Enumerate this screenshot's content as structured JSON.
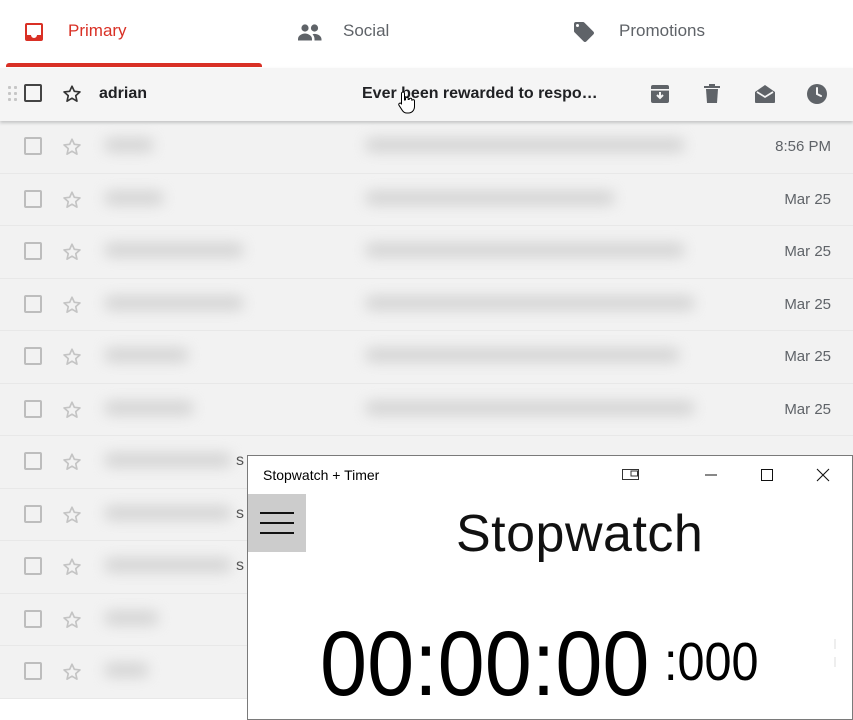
{
  "tabs": [
    {
      "label": "Primary",
      "icon": "inbox-icon",
      "active": true
    },
    {
      "label": "Social",
      "icon": "people-icon",
      "active": false
    },
    {
      "label": "Promotions",
      "icon": "tag-icon",
      "active": false
    }
  ],
  "hover_row": {
    "sender": "adrian",
    "subject": "Ever been rewarded to respo…",
    "actions": [
      "archive-icon",
      "delete-icon",
      "mark-read-icon",
      "snooze-icon"
    ]
  },
  "mail_rows": [
    {
      "date": "8:56 PM",
      "peek": ""
    },
    {
      "date": "Mar 25",
      "peek": ""
    },
    {
      "date": "Mar 25",
      "peek": ""
    },
    {
      "date": "Mar 25",
      "peek": ""
    },
    {
      "date": "Mar 25",
      "peek": ""
    },
    {
      "date": "Mar 25",
      "peek": ""
    },
    {
      "date": "",
      "peek": "s"
    },
    {
      "date": "",
      "peek": "s"
    },
    {
      "date": "",
      "peek": "s"
    },
    {
      "date": "",
      "peek": ""
    },
    {
      "date": "",
      "peek": ""
    }
  ],
  "stopwatch": {
    "window_title": "Stopwatch + Timer",
    "heading": "Stopwatch",
    "time": "00:00:00",
    "milliseconds": ":000"
  },
  "colors": {
    "gmail_red": "#d93025",
    "hover_bg": "#f5f5f5",
    "menu_bg": "#cccccc"
  }
}
